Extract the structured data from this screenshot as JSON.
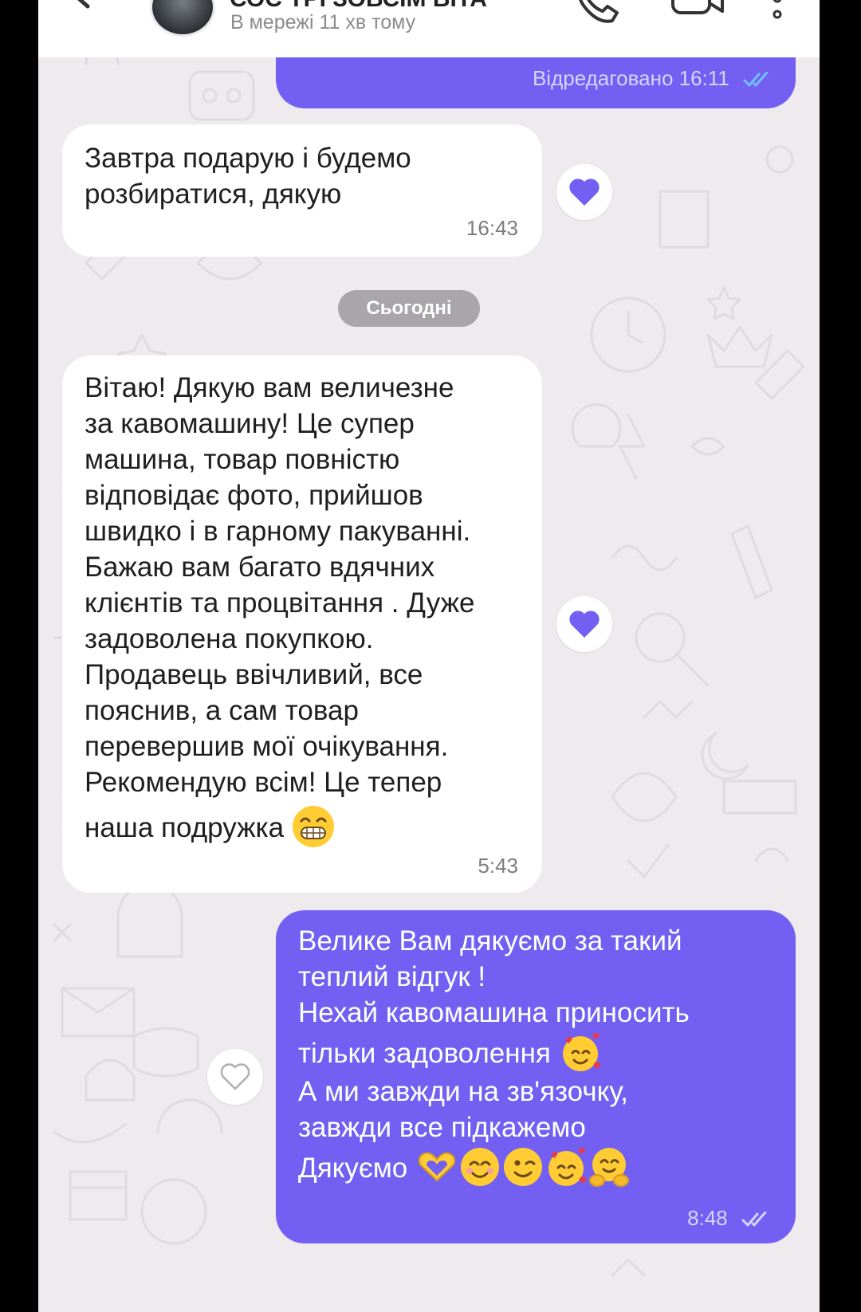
{
  "header": {
    "contact_name": "СОС ТРІ ЗОВСІМ ВІТА",
    "status": "В мережі 11 хв тому"
  },
  "messages": [
    {
      "direction": "outgoing",
      "text": "",
      "meta": "Відредаговано 16:11",
      "read": true
    },
    {
      "direction": "incoming",
      "text": "Завтра подарую і будемо\nрозбиратися, дякую",
      "time": "16:43",
      "reaction": "heart-filled"
    },
    {
      "direction": "incoming",
      "text": "Вітаю! Дякую вам величезне\nза кавомашину! Це супер\nмашина, товар повністю\nвідповідає фото, прийшов\nшвидко і в гарному пакуванні.\nБажаю вам багато вдячних\nклієнтів та процвітання . Дуже\nзадоволена покупкою.\nПродавець ввічливий, все\nпояснив, а сам товар\nперевершив мої очікування.\nРекомендую всім! Це тепер",
      "text_last": "наша подружка",
      "time": "5:43",
      "reaction": "heart-filled"
    },
    {
      "direction": "outgoing",
      "lines": [
        "Велике Вам дякуємо за такий",
        "теплий відгук !",
        "Нехай кавомашина приносить",
        "тільки задоволення",
        "А ми завжди на зв'язочку,",
        "завжди все підкажемо",
        "Дякуємо"
      ],
      "time": "8:48",
      "reaction": "heart-outline"
    }
  ],
  "date_separator": "Сьогодні",
  "colors": {
    "accent": "#7360f2",
    "background": "#eeeaee",
    "incoming_bubble": "#ffffff",
    "date_chip": "#a8a6ab"
  },
  "icons": [
    "back-arrow-icon",
    "phone-icon",
    "video-camera-icon",
    "more-vertical-icon",
    "heart-icon",
    "double-check-icon"
  ]
}
